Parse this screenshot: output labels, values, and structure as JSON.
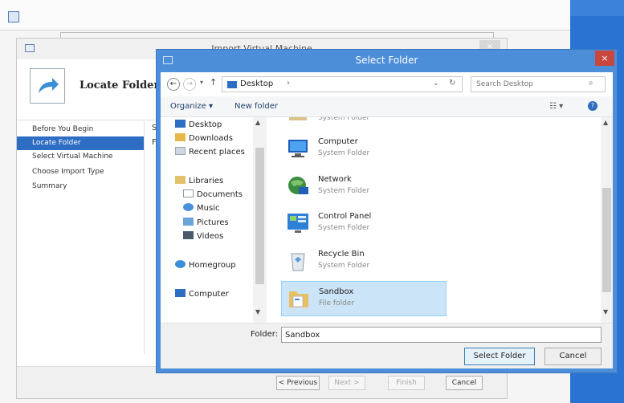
{
  "wizard": {
    "title": "Import Virtual Machine",
    "close_glyph": "×",
    "header_title": "Locate Folder",
    "nav_items": [
      {
        "label": "Before You Begin"
      },
      {
        "label": "Locate Folder"
      },
      {
        "label": "Select Virtual Machine"
      },
      {
        "label": "Choose Import Type"
      },
      {
        "label": "Summary"
      }
    ],
    "partial_label_1": "S",
    "partial_label_2": "F",
    "buttons": {
      "previous": "< Previous",
      "next": "Next >",
      "finish": "Finish",
      "cancel": "Cancel"
    }
  },
  "dialog": {
    "title": "Select Folder",
    "close_glyph": "×",
    "address": {
      "back_glyph": "←",
      "forward_glyph": "→",
      "recent_glyph": "▾",
      "up_glyph": "↑",
      "location": "Desktop",
      "chevron": "›",
      "dropdown_glyph": "⌄",
      "refresh_glyph": "↻"
    },
    "search": {
      "placeholder": "Search Desktop",
      "icon_glyph": "⌕"
    },
    "commands": {
      "organize": "Organize ▾",
      "new_folder": "New folder",
      "view_glyph": "☷ ▾",
      "help_glyph": "?"
    },
    "tree": {
      "scroll_up": "▲",
      "scroll_down": "▼",
      "items": [
        {
          "label": "Desktop",
          "icon": "desktop-icon"
        },
        {
          "label": "Downloads",
          "icon": "downloads-icon"
        },
        {
          "label": "Recent places",
          "icon": "recent-places-icon"
        },
        {
          "label": "Libraries",
          "icon": "libraries-icon"
        },
        {
          "label": "Documents",
          "icon": "documents-icon"
        },
        {
          "label": "Music",
          "icon": "music-icon"
        },
        {
          "label": "Pictures",
          "icon": "pictures-icon"
        },
        {
          "label": "Videos",
          "icon": "videos-icon"
        },
        {
          "label": "Homegroup",
          "icon": "homegroup-icon"
        },
        {
          "label": "Computer",
          "icon": "computer-icon"
        }
      ]
    },
    "files": {
      "scroll_up": "▲",
      "scroll_down": "▼",
      "items": [
        {
          "name": "",
          "type": "System Folder",
          "icon": "user-folder-icon"
        },
        {
          "name": "Computer",
          "type": "System Folder",
          "icon": "computer-icon"
        },
        {
          "name": "Network",
          "type": "System Folder",
          "icon": "network-icon"
        },
        {
          "name": "Control Panel",
          "type": "System Folder",
          "icon": "control-panel-icon"
        },
        {
          "name": "Recycle Bin",
          "type": "System Folder",
          "icon": "recycle-bin-icon"
        },
        {
          "name": "Sandbox",
          "type": "File folder",
          "icon": "folder-icon"
        }
      ]
    },
    "folder_label": "Folder:",
    "folder_value": "Sandbox",
    "buttons": {
      "select": "Select Folder",
      "cancel": "Cancel"
    }
  },
  "colors": {
    "accent": "#4d8ed8",
    "selection": "#cce4f7",
    "nav_active": "#2e6dc4",
    "close_red": "#c9463d"
  }
}
